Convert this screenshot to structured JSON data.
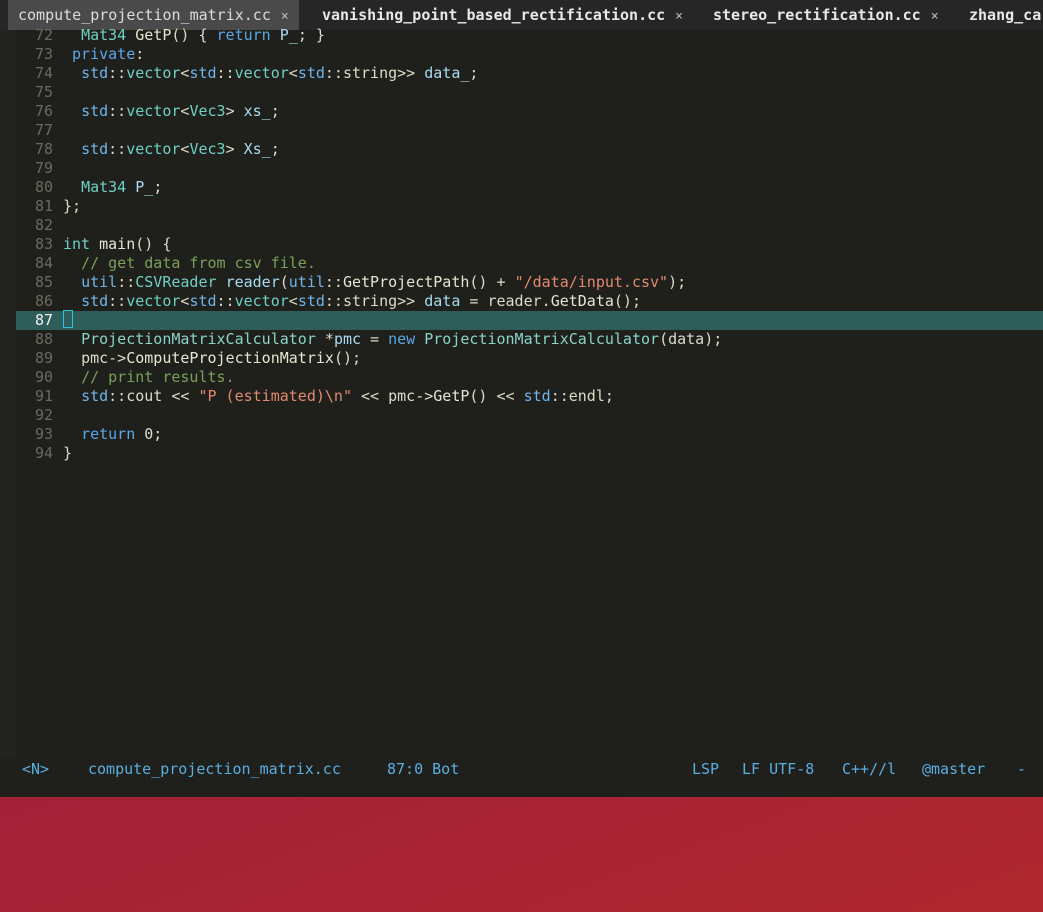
{
  "tabs": [
    {
      "name": "compute_projection_matrix.cc",
      "close": "×",
      "active": true
    },
    {
      "name": "vanishing_point_based_rectification.cc",
      "close": "×",
      "active": false
    },
    {
      "name": "stereo_rectification.cc",
      "close": "×",
      "active": false
    },
    {
      "name": "zhang_ca",
      "close": "",
      "active": false
    }
  ],
  "code": {
    "line_numbers": [
      "72",
      "73",
      "74",
      "75",
      "76",
      "77",
      "78",
      "79",
      "80",
      "81",
      "82",
      "83",
      "84",
      "85",
      "86",
      "87",
      "88",
      "89",
      "90",
      "91",
      "92",
      "93",
      "94"
    ],
    "current_line": "87"
  },
  "statusbar": {
    "mode": "<N>",
    "filename": "compute_projection_matrix.cc",
    "position": "87:0 Bot",
    "lsp": "LSP",
    "encoding": "LF UTF-8",
    "filetype": "C++//l",
    "branch": "@master",
    "trail": "-"
  }
}
